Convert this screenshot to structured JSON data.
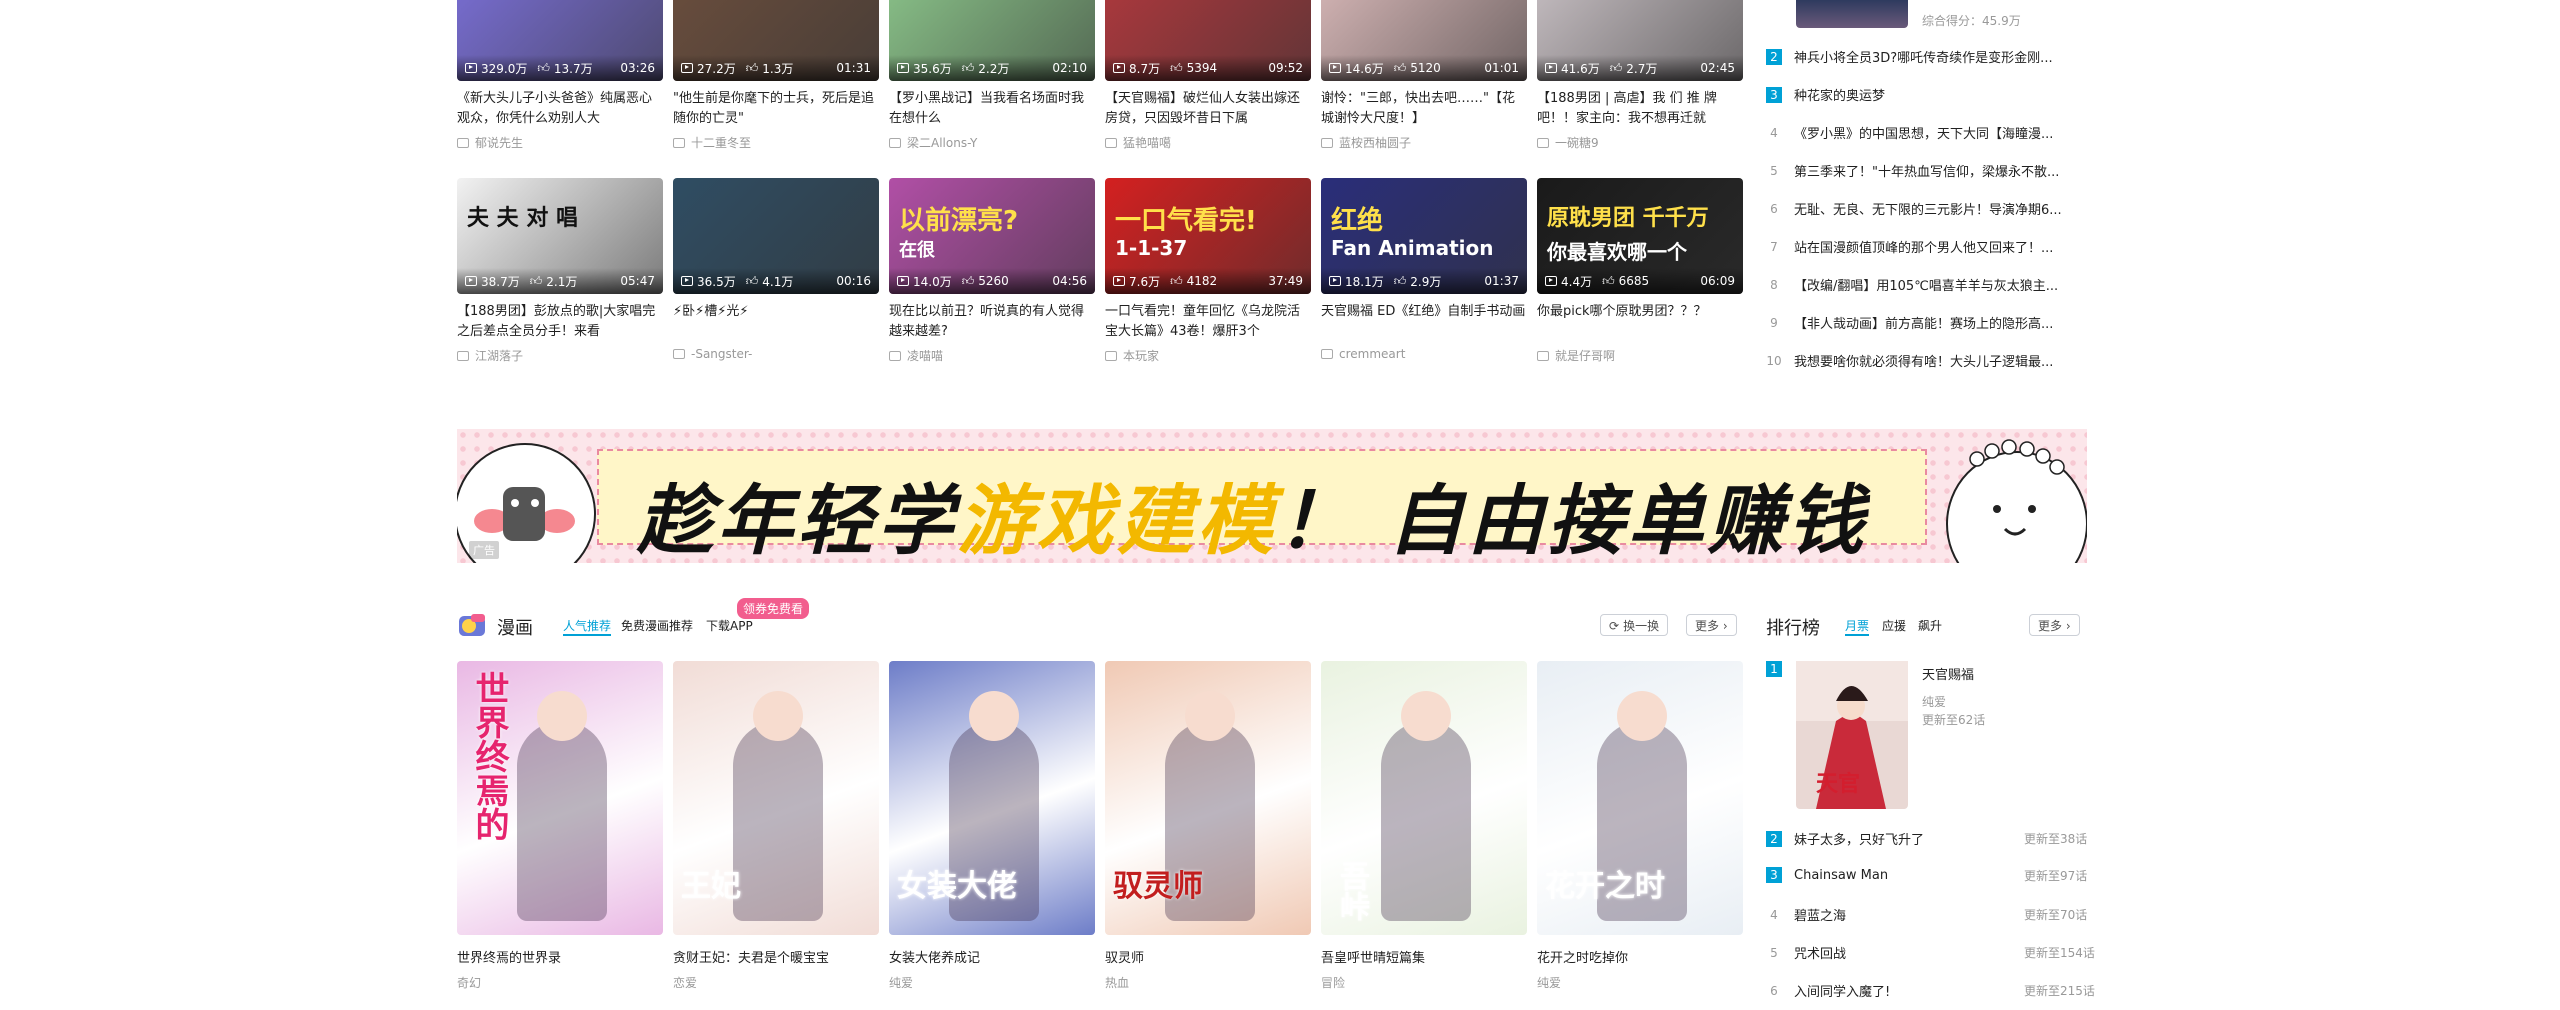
{
  "videos_row1": [
    {
      "views": "329.0万",
      "likes": "13.7万",
      "duration": "03:26",
      "title": "《新大头儿子小头爸爸》纯属恶心观众，你凭什么劝别人大",
      "up": "郁说先生",
      "bg": "#7a6fd6"
    },
    {
      "views": "27.2万",
      "likes": "1.3万",
      "duration": "01:31",
      "title": "\"他生前是你麾下的士兵，死后是追随你的亡灵\"",
      "up": "十二重冬至",
      "bg": "#6b4e3d"
    },
    {
      "views": "35.6万",
      "likes": "2.2万",
      "duration": "02:10",
      "title": "【罗小黑战记】当我看名场面时我在想什么",
      "up": "梁二Allons-Y",
      "bg": "#8bc48a"
    },
    {
      "views": "8.7万",
      "likes": "5394",
      "duration": "09:52",
      "title": "【天官赐福】破烂仙人女装出嫁还房贷，只因毁坏昔日下属",
      "up": "猛艳喵噶",
      "bg": "#b0383d"
    },
    {
      "views": "14.6万",
      "likes": "5120",
      "duration": "01:01",
      "title": "谢怜：\"三郎，快出去吧……\"【花城谢怜大尺度！】",
      "up": "蓝桉西柚圆子",
      "bg": "#d8b8b8"
    },
    {
      "views": "41.6万",
      "likes": "2.7万",
      "duration": "02:45",
      "title": "【188男团 | 高虐】我 们 推 牌 吧！！家主向：我不想再迁就",
      "up": "一碗糖9",
      "bg": "#c8c0c4"
    }
  ],
  "videos_row2": [
    {
      "views": "38.7万",
      "likes": "2.1万",
      "duration": "05:47",
      "title": "【188男团】彭放点的歌|大家唱完之后差点全员分手！来看",
      "up": "江湖落子",
      "thumb_text": "夫 夫 对 唱",
      "bg": "#f2f2f2"
    },
    {
      "views": "36.5万",
      "likes": "4.1万",
      "duration": "00:16",
      "title": "⚡卧⚡槽⚡光⚡",
      "up": "-Sangster-",
      "bg": "#2f4d63"
    },
    {
      "views": "14.0万",
      "likes": "5260",
      "duration": "04:56",
      "title": "现在比以前丑？听说真的有人觉得越来越差?",
      "up": "凌喵喵",
      "thumb_text": "以前漂亮?",
      "overlay": "在很",
      "bg": "#b14fa6"
    },
    {
      "views": "7.6万",
      "likes": "4182",
      "duration": "37:49",
      "title": "一口气看完！童年回忆《乌龙院活宝大长篇》43卷！爆肝3个",
      "up": "本玩家",
      "thumb_text": "一口气看完!",
      "overlay": "1-1-37",
      "bg": "#d42020"
    },
    {
      "views": "18.1万",
      "likes": "2.9万",
      "duration": "01:37",
      "title": "天官赐福 ED《红绝》自制手书动画",
      "up": "cremmeart",
      "thumb_text": "红绝",
      "overlay": "Fan Animation",
      "bg": "#2a2e7a"
    },
    {
      "views": "4.4万",
      "likes": "6685",
      "duration": "06:09",
      "title": "你最pick哪个原耽男团？？？",
      "up": "就是仔哥啊",
      "thumb_text": "原耽男团 千千万",
      "overlay": "你最喜欢哪一个",
      "bg": "#1a1a1a"
    }
  ],
  "video_rank": {
    "score_label": "综合得分：45.9万",
    "items": [
      {
        "no": "2",
        "title": "神兵小将全员3D?哪吒传奇续作是变形金刚..."
      },
      {
        "no": "3",
        "title": "种花家的奥运梦"
      },
      {
        "no": "4",
        "title": "《罗小黑》的中国思想，天下大同【海瞳漫..."
      },
      {
        "no": "5",
        "title": "第三季来了！\"十年热血写信仰，梁爆永不散..."
      },
      {
        "no": "6",
        "title": "无耻、无良、无下限的三元影片！导演净期6..."
      },
      {
        "no": "7",
        "title": "站在国漫颜值顶峰的那个男人他又回来了！..."
      },
      {
        "no": "8",
        "title": "【改编/翻唱】用105℃唱喜羊羊与灰太狼主..."
      },
      {
        "no": "9",
        "title": "【非人哉动画】前方高能！赛场上的隐形高..."
      },
      {
        "no": "10",
        "title": "我想要啥你就必须得有啥！大头儿子逻辑最..."
      }
    ]
  },
  "banner": {
    "ad_badge": "广告",
    "text_a": "趁年轻学",
    "text_hl": "游戏建模",
    "text_b": "！ 自由接单赚钱"
  },
  "comics_section": {
    "title": "漫画",
    "tabs": [
      "人气推荐",
      "免费漫画推荐",
      "下载APP"
    ],
    "promo_badge": "领券免费看",
    "refresh_label": "换一换",
    "more_label": "更多",
    "items": [
      {
        "title": "世界终焉的世界录",
        "tag": "奇幻",
        "cover_text": "世界终焉的",
        "bg": "#e9b8e4"
      },
      {
        "title": "贪财王妃：夫君是个暖宝宝",
        "tag": "恋爱",
        "cover_text": "王妃",
        "bg": "#f1dcd6"
      },
      {
        "title": "女装大佬养成记",
        "tag": "纯爱",
        "cover_text": "女装大佬",
        "bg": "#6d7dc8"
      },
      {
        "title": "驭灵师",
        "tag": "热血",
        "cover_text": "驭灵师",
        "bg": "#f0c9b4"
      },
      {
        "title": "吾皇呼世晴短篇集",
        "tag": "冒险",
        "cover_text": "吾峠",
        "bg": "#e9f2e0"
      },
      {
        "title": "花开之时吃掉你",
        "tag": "纯爱",
        "cover_text": "花开之时",
        "bg": "#e8eef4"
      }
    ]
  },
  "comic_rank": {
    "title": "排行榜",
    "tabs": [
      "月票",
      "应援",
      "飙升"
    ],
    "more_label": "更多",
    "top": {
      "no": "1",
      "title": "天官赐福",
      "tag": "纯爱",
      "update": "更新至62话"
    },
    "items": [
      {
        "no": "2",
        "title": "妹子太多，只好飞升了",
        "update": "更新至38话"
      },
      {
        "no": "3",
        "title": "Chainsaw Man",
        "update": "更新至97话"
      },
      {
        "no": "4",
        "title": "碧蓝之海",
        "update": "更新至70话"
      },
      {
        "no": "5",
        "title": "咒术回战",
        "update": "更新至154话"
      },
      {
        "no": "6",
        "title": "入间同学入魔了!",
        "update": "更新至215话"
      }
    ]
  },
  "colors": {
    "accent": "#00a1d6",
    "promo": "#f25d8e"
  }
}
